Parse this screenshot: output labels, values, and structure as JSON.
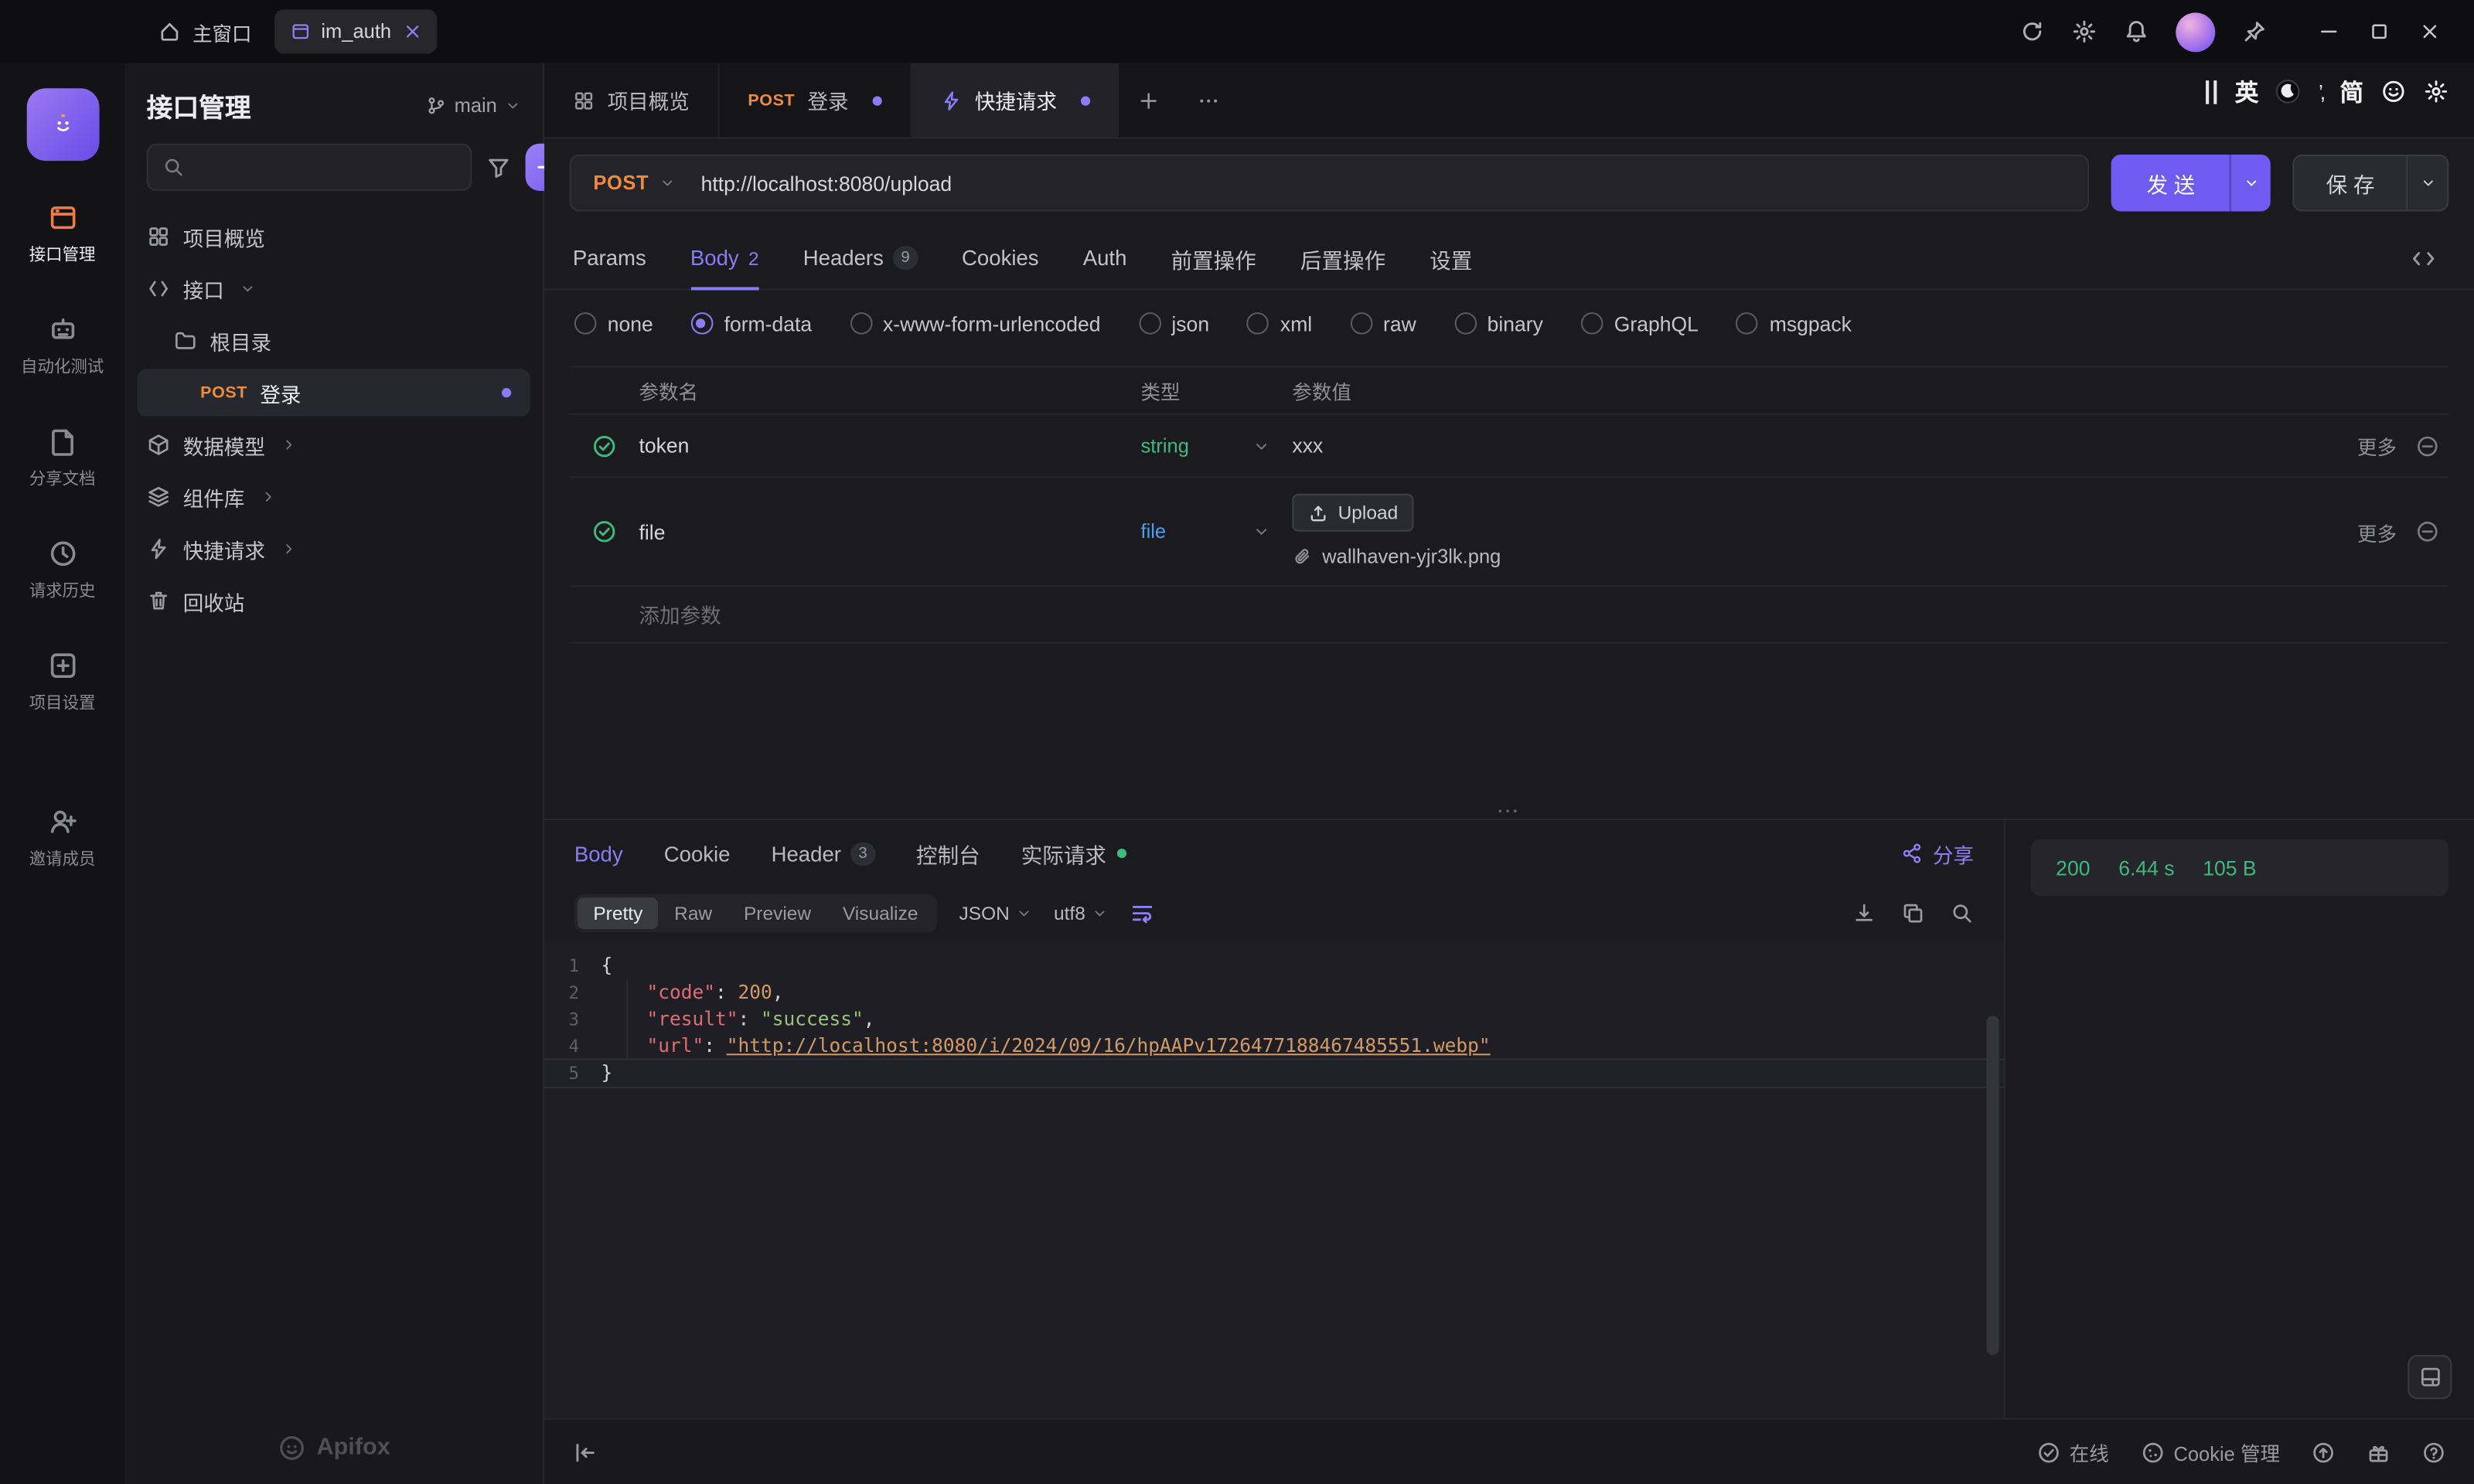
{
  "titlebar": {
    "home": "主窗口",
    "doc_tab": "im_auth"
  },
  "ime": {
    "en": "英",
    "cn": "简"
  },
  "rail": {
    "items": [
      {
        "id": "api",
        "label": "接口管理",
        "active": true
      },
      {
        "id": "test",
        "label": "自动化测试"
      },
      {
        "id": "share",
        "label": "分享文档"
      },
      {
        "id": "history",
        "label": "请求历史"
      },
      {
        "id": "settings",
        "label": "项目设置"
      },
      {
        "id": "invite",
        "label": "邀请成员"
      }
    ]
  },
  "sidebar": {
    "title": "接口管理",
    "branch": "main",
    "items": [
      {
        "icon": "grid",
        "label": "项目概览",
        "indent": 0
      },
      {
        "icon": "api",
        "label": "接口",
        "indent": 0,
        "caret": "down"
      },
      {
        "icon": "folder",
        "label": "根目录",
        "indent": 1
      },
      {
        "method": "POST",
        "label": "登录",
        "indent": 2,
        "selected": true,
        "dot": true
      },
      {
        "icon": "cube",
        "label": "数据模型",
        "indent": 0,
        "caret": "right"
      },
      {
        "icon": "layers",
        "label": "组件库",
        "indent": 0,
        "caret": "right"
      },
      {
        "icon": "bolt",
        "label": "快捷请求",
        "indent": 0,
        "caret": "right"
      },
      {
        "icon": "trash",
        "label": "回收站",
        "indent": 0
      }
    ],
    "logo": "Apifox"
  },
  "doctabs": [
    {
      "icon": "grid",
      "label": "项目概览"
    },
    {
      "method": "POST",
      "label": "登录",
      "dot": true
    },
    {
      "icon": "bolt",
      "label": "快捷请求",
      "dot": true,
      "active": true
    }
  ],
  "request": {
    "method": "POST",
    "url": "http://localhost:8080/upload",
    "send": "发 送",
    "save": "保 存"
  },
  "reqtabs": [
    {
      "label": "Params"
    },
    {
      "label": "Body",
      "active": true,
      "count": "2"
    },
    {
      "label": "Headers",
      "badge": "9"
    },
    {
      "label": "Cookies"
    },
    {
      "label": "Auth"
    },
    {
      "label": "前置操作"
    },
    {
      "label": "后置操作"
    },
    {
      "label": "设置"
    }
  ],
  "bodytypes": {
    "options": [
      "none",
      "form-data",
      "x-www-form-urlencoded",
      "json",
      "xml",
      "raw",
      "binary",
      "GraphQL",
      "msgpack"
    ],
    "selected": "form-data"
  },
  "params": {
    "headers": [
      "参数名",
      "类型",
      "参数值"
    ],
    "rows": [
      {
        "name": "token",
        "type": "string",
        "typeColor": "green",
        "value": "xxx",
        "more": "更多"
      },
      {
        "name": "file",
        "type": "file",
        "typeColor": "blue",
        "upload": "Upload",
        "file": "wallhaven-yjr3lk.png",
        "more": "更多"
      }
    ],
    "add": "添加参数"
  },
  "response": {
    "tabs": [
      {
        "label": "Body",
        "active": true
      },
      {
        "label": "Cookie"
      },
      {
        "label": "Header",
        "badge": "3"
      },
      {
        "label": "控制台"
      },
      {
        "label": "实际请求",
        "dot": true
      }
    ],
    "share": "分享",
    "status": {
      "code": "200",
      "time": "6.44 s",
      "size": "105 B"
    },
    "modes": [
      "Pretty",
      "Raw",
      "Preview",
      "Visualize"
    ],
    "mode_active": "Pretty",
    "format": "JSON",
    "encoding": "utf8",
    "code": [
      [
        [
          "p",
          "{"
        ]
      ],
      [
        [
          "p",
          "    "
        ],
        [
          "key",
          "\"code\""
        ],
        [
          "p",
          ": "
        ],
        [
          "num",
          "200"
        ],
        [
          "p",
          ","
        ]
      ],
      [
        [
          "p",
          "    "
        ],
        [
          "key",
          "\"result\""
        ],
        [
          "p",
          ": "
        ],
        [
          "str",
          "\"success\""
        ],
        [
          "p",
          ","
        ]
      ],
      [
        [
          "p",
          "    "
        ],
        [
          "key",
          "\"url\""
        ],
        [
          "p",
          ": "
        ],
        [
          "link",
          "\"http://localhost:8080/i/2024/09/16/hpAAPv1726477188467485551.webp\""
        ]
      ],
      [
        [
          "p",
          "}"
        ]
      ]
    ]
  },
  "statusbar": {
    "online": "在线",
    "cookie": "Cookie 管理"
  }
}
